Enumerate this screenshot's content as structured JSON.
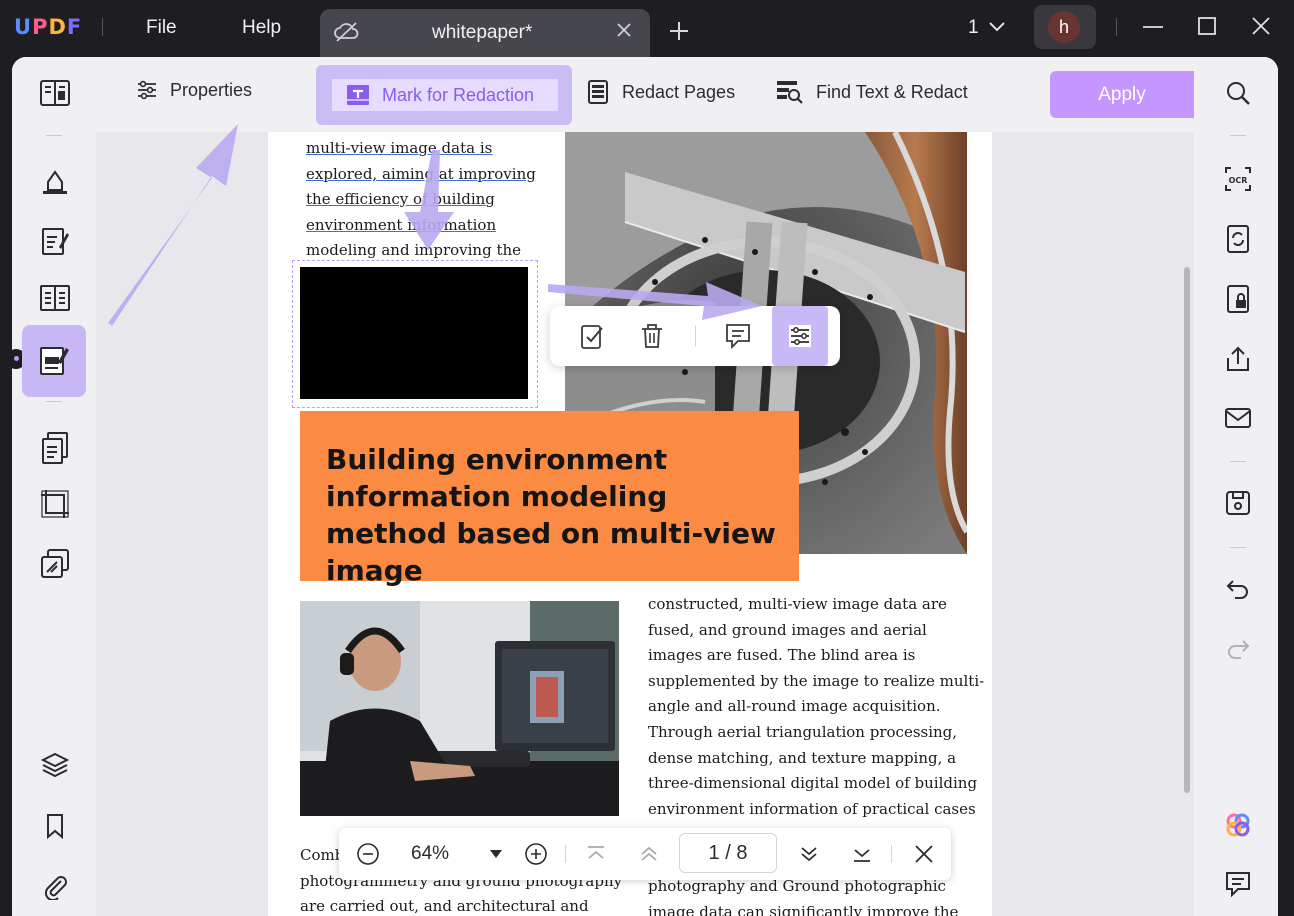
{
  "app": {
    "logo": "UPDF",
    "menu": [
      "File",
      "Help"
    ],
    "tab_title": "whitepaper*",
    "page_indicator": "1",
    "avatar_initial": "h"
  },
  "toolbar": {
    "properties_label": "Properties",
    "mark_label": "Mark for Redaction",
    "redact_pages_label": "Redact Pages",
    "find_redact_label": "Find Text & Redact",
    "apply_label": "Apply"
  },
  "document": {
    "col1_lines": [
      "multi-view image data is",
      "explored, aiming at improving",
      "the efficiency of building",
      "environment information",
      "modeling and improving the"
    ],
    "heading": "Building environment information modeling method based on multi-view image",
    "col2_lines": [
      "constructed, multi-view image data are",
      "fused, and ground images and aerial",
      "images are fused. The blind area is",
      "supplemented by the image to realize multi-",
      "angle and all-round image acquisition.",
      "Through aerial triangulation processing,",
      "dense matching, and texture mapping, a",
      "three-dimensional digital model of building",
      "environment information of practical cases"
    ],
    "col1b_lines": [
      "Comb",
      "photogrammetry and ground photography",
      "are carried out, and architectural and"
    ],
    "col2b_lines": [
      "photography and Ground photographic",
      "image data can significantly improve the"
    ]
  },
  "zoombar": {
    "zoom": "64%",
    "page": "1 / 8"
  },
  "colors": {
    "accent": "#8a5cf0",
    "apply": "#c596ff",
    "heading_bg": "#fb8a42",
    "annotation_arrow": "#b9a8f0"
  }
}
